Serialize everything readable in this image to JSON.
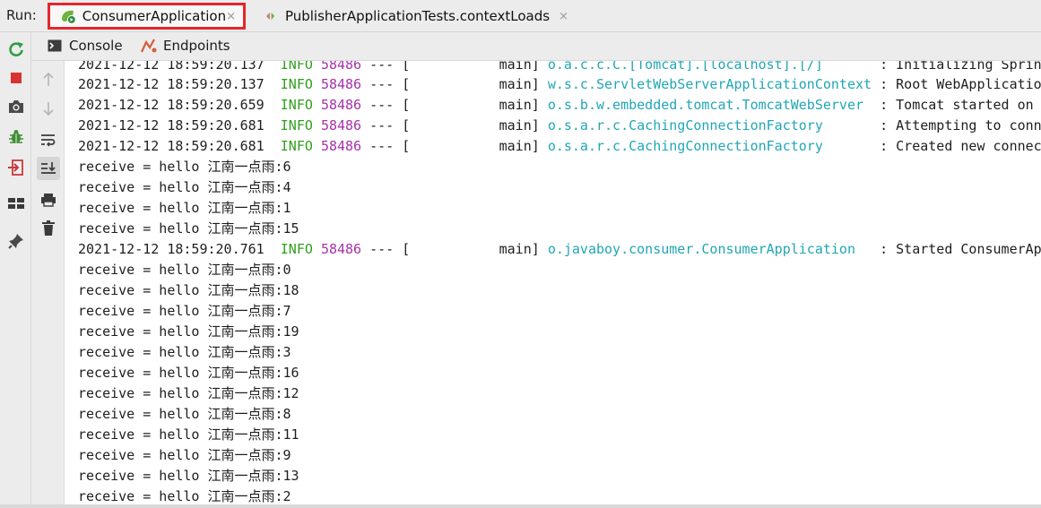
{
  "run": {
    "label": "Run:",
    "tabs": [
      {
        "label": "ConsumerApplication",
        "close": "×"
      },
      {
        "label": "PublisherApplicationTests.contextLoads",
        "close": "×"
      }
    ]
  },
  "console_header": {
    "tabs": [
      {
        "label": "Console"
      },
      {
        "label": "Endpoints"
      }
    ]
  },
  "colors": {
    "info": "#2f9f1b",
    "pid": "#a531a8",
    "logger": "#22a6b5",
    "highlight": "#e4262c"
  },
  "log": {
    "line0": {
      "ts": "2021-12-12 18:59:20.137",
      "level": "INFO",
      "pid": "58486",
      "sep": "---",
      "thread": "[           main]",
      "logger": "o.a.c.c.C.[Tomcat].[localhost].[/]      ",
      "msg": ": Initializing Spring"
    },
    "line1": {
      "ts": "2021-12-12 18:59:20.137",
      "level": "INFO",
      "pid": "58486",
      "sep": "---",
      "thread": "[           main]",
      "logger": "w.s.c.ServletWebServerApplicationContext",
      "msg": ": Root WebApplication"
    },
    "line2": {
      "ts": "2021-12-12 18:59:20.659",
      "level": "INFO",
      "pid": "58486",
      "sep": "---",
      "thread": "[           main]",
      "logger": "o.s.b.w.embedded.tomcat.TomcatWebServer ",
      "msg": ": Tomcat started on p"
    },
    "line3": {
      "ts": "2021-12-12 18:59:20.681",
      "level": "INFO",
      "pid": "58486",
      "sep": "---",
      "thread": "[           main]",
      "logger": "o.s.a.r.c.CachingConnectionFactory      ",
      "msg": ": Attempting to conne"
    },
    "line4": {
      "ts": "2021-12-12 18:59:20.681",
      "level": "INFO",
      "pid": "58486",
      "sep": "---",
      "thread": "[           main]",
      "logger": "o.s.a.r.c.CachingConnectionFactory      ",
      "msg": ": Created new connect"
    },
    "line5": {
      "text": "receive = hello 江南一点雨:6"
    },
    "line6": {
      "text": "receive = hello 江南一点雨:4"
    },
    "line7": {
      "text": "receive = hello 江南一点雨:1"
    },
    "line8": {
      "text": "receive = hello 江南一点雨:15"
    },
    "line9": {
      "ts": "2021-12-12 18:59:20.761",
      "level": "INFO",
      "pid": "58486",
      "sep": "---",
      "thread": "[           main]",
      "logger": "o.javaboy.consumer.ConsumerApplication  ",
      "msg": ": Started ConsumerApp"
    },
    "line10": {
      "text": "receive = hello 江南一点雨:0"
    },
    "line11": {
      "text": "receive = hello 江南一点雨:18"
    },
    "line12": {
      "text": "receive = hello 江南一点雨:7"
    },
    "line13": {
      "text": "receive = hello 江南一点雨:19"
    },
    "line14": {
      "text": "receive = hello 江南一点雨:3"
    },
    "line15": {
      "text": "receive = hello 江南一点雨:16"
    },
    "line16": {
      "text": "receive = hello 江南一点雨:12"
    },
    "line17": {
      "text": "receive = hello 江南一点雨:8"
    },
    "line18": {
      "text": "receive = hello 江南一点雨:11"
    },
    "line19": {
      "text": "receive = hello 江南一点雨:9"
    },
    "line20": {
      "text": "receive = hello 江南一点雨:13"
    },
    "line21": {
      "text": "receive = hello 江南一点雨:2"
    }
  }
}
